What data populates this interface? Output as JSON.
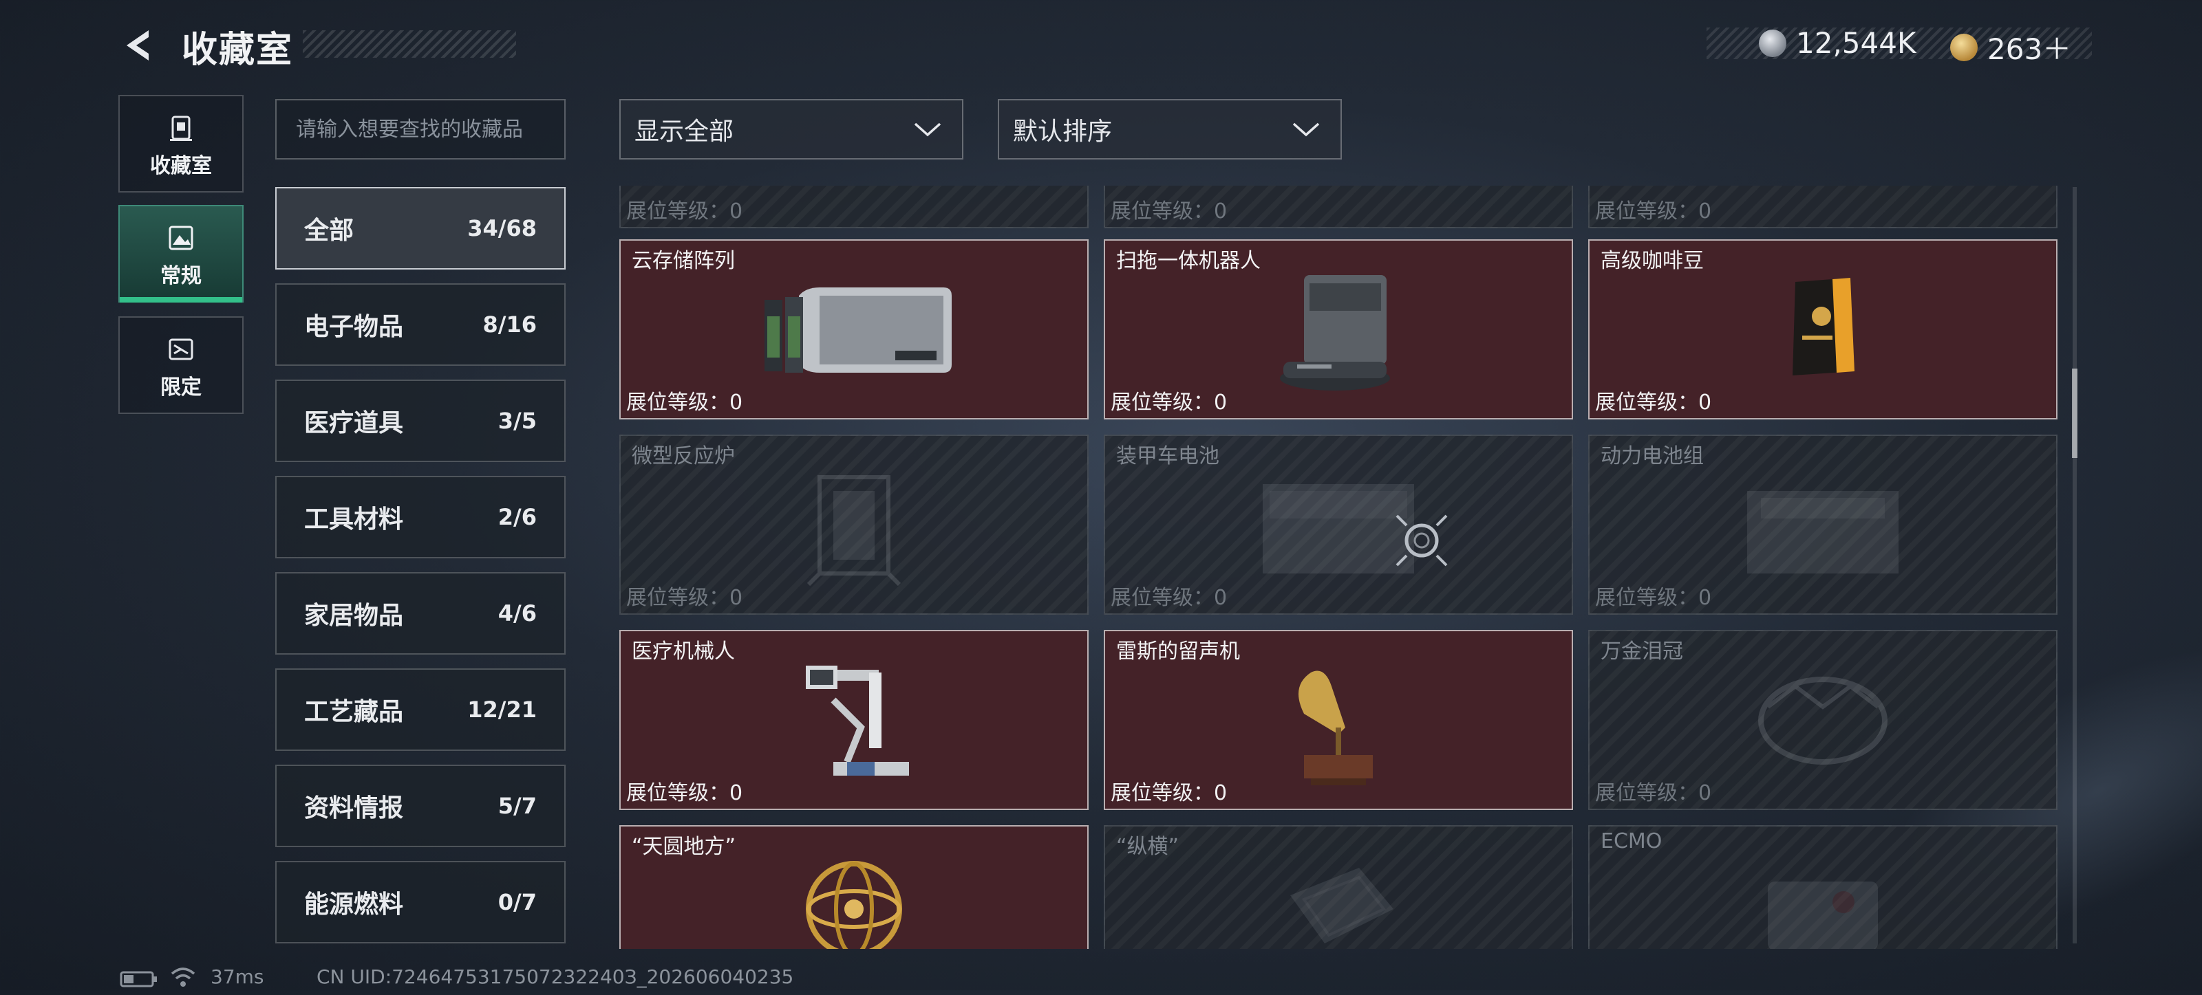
{
  "header": {
    "title": "收藏室"
  },
  "currency": [
    {
      "icon": "silver-coin-icon",
      "value": "12,544K"
    },
    {
      "icon": "gold-coin-icon",
      "value": "263＋"
    }
  ],
  "nav": [
    {
      "label": "收藏室",
      "icon": "collection-room-icon",
      "active": false
    },
    {
      "label": "常规",
      "icon": "regular-icon",
      "active": true
    },
    {
      "label": "限定",
      "icon": "limited-icon",
      "active": false
    }
  ],
  "search": {
    "placeholder": "请输入想要查找的收藏品"
  },
  "filters": {
    "show": "显示全部",
    "sort": "默认排序"
  },
  "categories": [
    {
      "label": "全部",
      "count": "34/68",
      "active": true
    },
    {
      "label": "电子物品",
      "count": "8/16"
    },
    {
      "label": "医疗道具",
      "count": "3/5"
    },
    {
      "label": "工具材料",
      "count": "2/6"
    },
    {
      "label": "家居物品",
      "count": "4/6"
    },
    {
      "label": "工艺藏品",
      "count": "12/21"
    },
    {
      "label": "资料情报",
      "count": "5/7"
    },
    {
      "label": "能源燃料",
      "count": "0/7"
    }
  ],
  "level_text": "展位等级：0",
  "items": [
    {
      "name": "",
      "owned": false,
      "art": "none"
    },
    {
      "name": "",
      "owned": false,
      "art": "none"
    },
    {
      "name": "",
      "owned": false,
      "art": "none"
    },
    {
      "name": "云存储阵列",
      "owned": true,
      "art": "server"
    },
    {
      "name": "扫拖一体机器人",
      "owned": true,
      "art": "robot-vacuum"
    },
    {
      "name": "高级咖啡豆",
      "owned": true,
      "art": "coffee-bag"
    },
    {
      "name": "微型反应炉",
      "owned": false,
      "art": "reactor"
    },
    {
      "name": "装甲车电池",
      "owned": false,
      "art": "battery"
    },
    {
      "name": "动力电池组",
      "owned": false,
      "art": "battery-pack"
    },
    {
      "name": "医疗机械人",
      "owned": true,
      "art": "medical-robot"
    },
    {
      "name": "雷斯的留声机",
      "owned": true,
      "art": "gramophone"
    },
    {
      "name": "万金泪冠",
      "owned": false,
      "art": "crown"
    },
    {
      "name": "“天圆地方”",
      "owned": true,
      "art": "armillary"
    },
    {
      "name": "“纵横”",
      "owned": false,
      "art": "board"
    },
    {
      "name": "ECMO",
      "owned": false,
      "art": "ecmo"
    }
  ],
  "status": {
    "ping": "37ms",
    "uid": "CN UID:7246475317507232240З_202606040235"
  }
}
